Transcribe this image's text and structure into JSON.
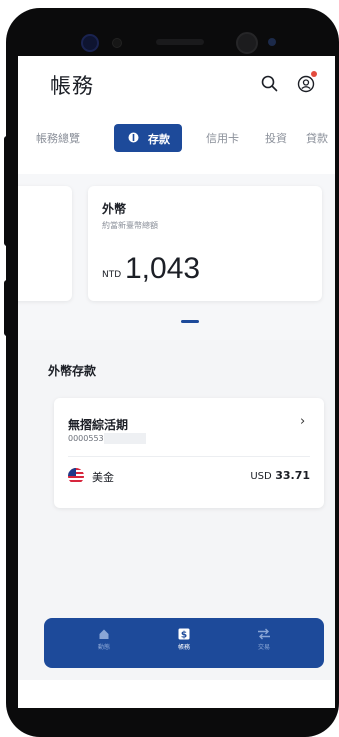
{
  "header": {
    "title": "帳務"
  },
  "tabs": {
    "items": [
      {
        "label": "帳務總覽"
      },
      {
        "label": "存款"
      },
      {
        "label": "信用卡"
      },
      {
        "label": "投資"
      },
      {
        "label": "貸款"
      }
    ],
    "active": "存款"
  },
  "fx_card": {
    "title": "外幣",
    "subtitle": "約當新臺幣總額",
    "currency": "NTD",
    "amount": "1,043"
  },
  "section": {
    "title": "外幣存款"
  },
  "account": {
    "name": "無摺綜活期",
    "number_prefix": "0000553",
    "currency_name": "美金",
    "currency_code": "USD",
    "balance": "33.71"
  },
  "bottom_nav": {
    "items": [
      {
        "label": "動態",
        "icon": "home-icon"
      },
      {
        "label": "帳務",
        "icon": "dollar-icon"
      },
      {
        "label": "交易",
        "icon": "transfer-icon"
      }
    ],
    "active": "帳務"
  },
  "colors": {
    "accent": "#1d4a9a",
    "notification": "#e34b3e"
  }
}
